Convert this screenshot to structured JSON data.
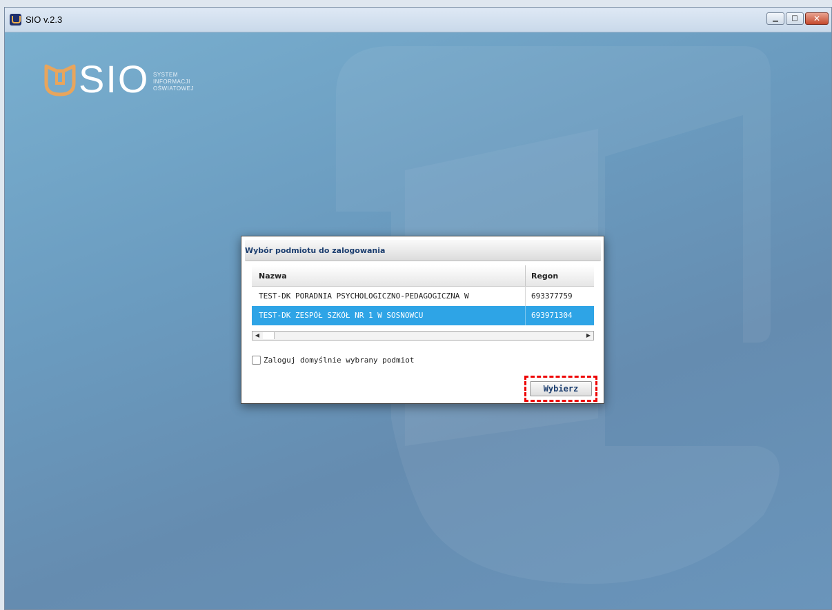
{
  "window": {
    "title": "SIO v.2.3",
    "controls": {
      "minimize": "minimize-icon",
      "maximize": "maximize-icon",
      "close": "close-icon"
    }
  },
  "branding": {
    "logo": "SIO",
    "subtitle": [
      "SYSTEM",
      "INFORMACJI",
      "OŚWIATOWEJ"
    ],
    "accent_color": "#e8a55c"
  },
  "dialog": {
    "title": "Wybór podmiotu do zalogowania",
    "columns": [
      "Nazwa",
      "Regon"
    ],
    "rows": [
      {
        "nazwa": "TEST-DK PORADNIA PSYCHOLOGICZNO-PEDAGOGICZNA W",
        "regon": "693377759",
        "selected": false
      },
      {
        "nazwa": "TEST-DK ZESPÓŁ SZKÓŁ NR 1 W SOSNOWCU",
        "regon": "693971304",
        "selected": true
      }
    ],
    "selection_color": "#2ea4e6",
    "checkbox_label": "Zaloguj domyślnie wybrany podmiot",
    "checkbox_checked": false,
    "button_label": "Wybierz"
  }
}
